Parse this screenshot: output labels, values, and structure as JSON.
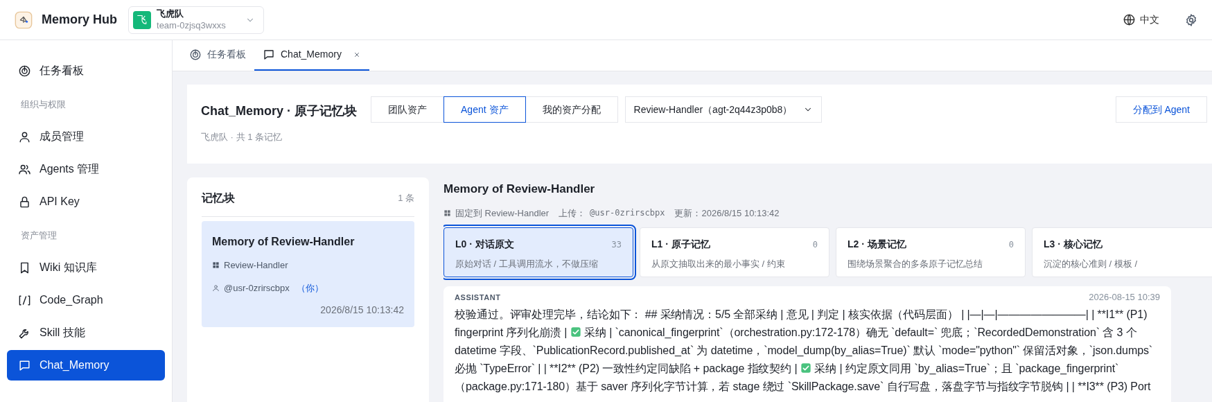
{
  "app": {
    "name": "Memory Hub",
    "team": {
      "avatar": "飞",
      "name": "飞虎队",
      "id": "team-0zjsq3wxxs"
    },
    "language": "中文"
  },
  "sidebar": {
    "items": [
      {
        "kind": "item",
        "label": "任务看板",
        "selected": false
      },
      {
        "kind": "section",
        "label": "组织与权限"
      },
      {
        "kind": "item",
        "label": "成员管理",
        "selected": false
      },
      {
        "kind": "item",
        "label": "Agents 管理",
        "selected": false
      },
      {
        "kind": "item",
        "label": "API Key",
        "selected": false
      },
      {
        "kind": "section",
        "label": "资产管理"
      },
      {
        "kind": "item",
        "label": "Wiki 知识库",
        "selected": false
      },
      {
        "kind": "item",
        "label": "Code_Graph",
        "selected": false
      },
      {
        "kind": "item",
        "label": "Skill 技能",
        "selected": false
      },
      {
        "kind": "item",
        "label": "Chat_Memory",
        "selected": true
      }
    ]
  },
  "tabs": [
    {
      "label": "任务看板",
      "selected": false,
      "closable": false
    },
    {
      "label": "Chat_Memory",
      "selected": true,
      "closable": true
    }
  ],
  "header": {
    "title": "Chat_Memory · 原子记忆块",
    "subtitle": "飞虎队 · 共 1 条记忆",
    "scope_tabs": [
      {
        "label": "团队资产",
        "selected": false
      },
      {
        "label": "Agent 资产",
        "selected": true
      },
      {
        "label": "我的资产分配",
        "selected": false
      }
    ],
    "agent_select": "Review-Handler（agt-2q44z3p0b8）",
    "assign_button": "分配到 Agent"
  },
  "memory_list": {
    "title": "记忆块",
    "count": "1 条",
    "items": [
      {
        "title": "Memory of Review-Handler",
        "agent": "Review-Handler",
        "user": "@usr-0zrirscbpx",
        "you": "（你）",
        "time": "2026/8/15 10:13:42",
        "selected": true
      }
    ]
  },
  "detail": {
    "title": "Memory of Review-Handler",
    "pinned": "固定到 Review-Handler",
    "upload_label": "上传：",
    "uploader": "@usr-0zrirscbpx",
    "updated": "更新：2026/8/15 10:13:42",
    "levels": [
      {
        "name": "L0 · 对话原文",
        "count": "33",
        "description": "原始对话 / 工具调用流水，不做压缩",
        "selected": true
      },
      {
        "name": "L1 · 原子记忆",
        "count": "0",
        "description": "从原文抽取出来的最小事实 / 约束",
        "selected": false
      },
      {
        "name": "L2 · 场景记忆",
        "count": "0",
        "description": "围绕场景聚合的多条原子记忆总结",
        "selected": false
      },
      {
        "name": "L3 · 核心记忆",
        "description": "沉淀的核心准则 / 模板 /",
        "selected": false
      }
    ],
    "message": {
      "role": "ASSISTANT",
      "time": "2026-08-15 10:39",
      "segments": [
        {
          "kind": "text",
          "text": "校验通过。评审处理完毕，结论如下： ## 采纳情况：5/5 全部采纳 | 意见 | 判定 | 核实依据（代码层面） | |—|—|————————| | **I1** (P1) fingerprint 序列化崩溃 | "
        },
        {
          "kind": "check"
        },
        {
          "kind": "text",
          "text": " 采纳 | `canonical_fingerprint`（orchestration.py:172-178）确无 `default=` 兜底；`RecordedDemonstration` 含 3 个 datetime 字段、`PublicationRecord.published_at` 为 datetime，`model_dump(by_alias=True)` 默认 `mode=\"python\"` 保留活对象，`json.dumps` 必抛 `TypeError` | | **I2** (P2) 一致性约定同缺陷 + package 指纹契约 | "
        },
        {
          "kind": "check"
        },
        {
          "kind": "text",
          "text": " 采纳 | 约定原文同用 `by_alias=True`；且 `package_fingerprint`（package.py:171-180）基于 saver 序列化字节计算，若 stage 绕过 `SkillPackage.save` 自行写盘，落盘字节与指纹字节脱钩 | | **I3** (P3) Port"
        }
      ]
    }
  }
}
